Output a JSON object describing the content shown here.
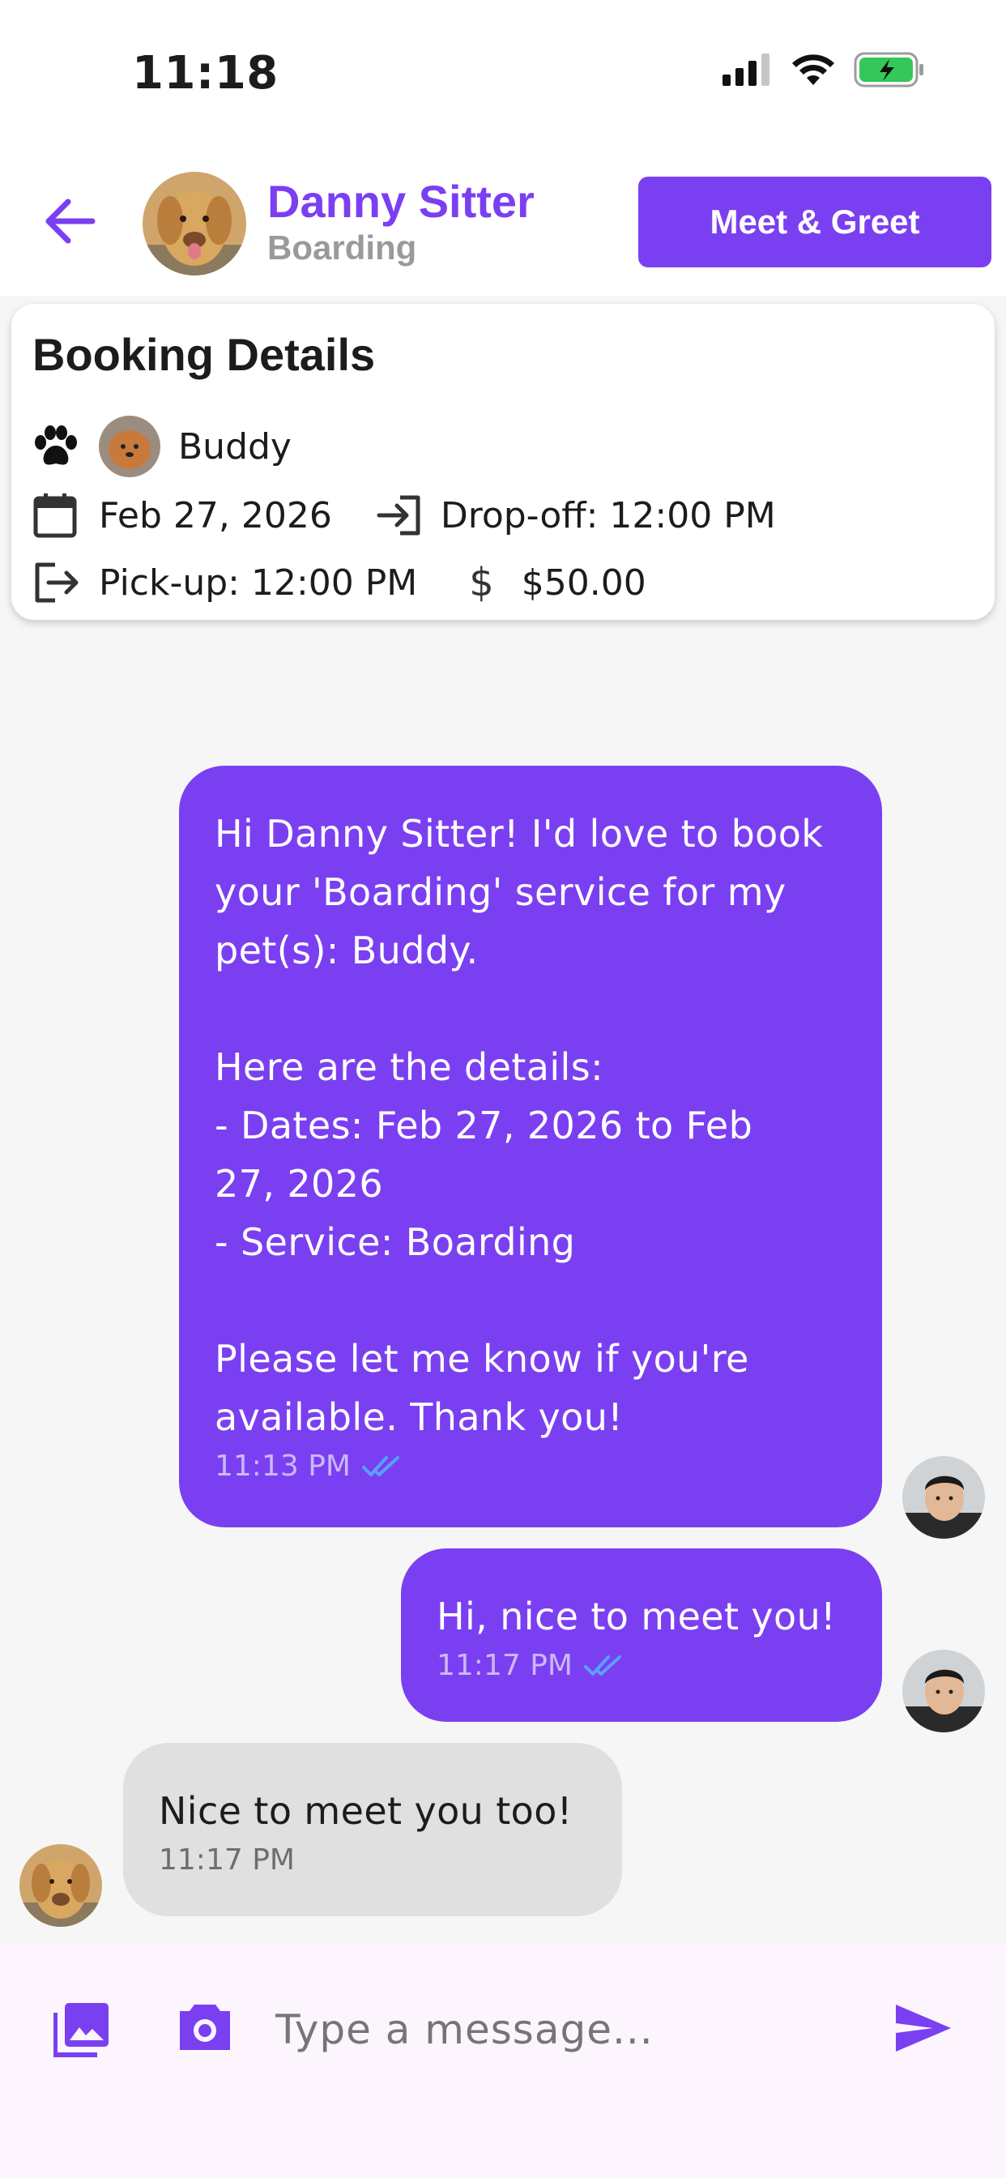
{
  "status_bar": {
    "time": "11:18"
  },
  "header": {
    "name": "Danny Sitter",
    "subtitle": "Boarding",
    "meet_button_label": "Meet & Greet"
  },
  "booking": {
    "title": "Booking Details",
    "pet_name": "Buddy",
    "date": "Feb 27, 2026",
    "dropoff": "Drop-off: 12:00 PM",
    "pickup": "Pick-up: 12:00 PM",
    "price": "$50.00"
  },
  "messages": [
    {
      "direction": "outgoing",
      "text": "Hi Danny Sitter! I'd love to book\nyour 'Boarding' service for my\npet(s): Buddy.\n\nHere are the details:\n- Dates: Feb 27, 2026 to Feb\n27, 2026\n- Service: Boarding\n\nPlease let me know if you're\navailable. Thank you!",
      "time": "11:13 PM",
      "status": "read"
    },
    {
      "direction": "outgoing",
      "text": "Hi, nice to meet you!",
      "time": "11:17 PM",
      "status": "read"
    },
    {
      "direction": "incoming",
      "text": "Nice to meet you too!",
      "time": "11:17 PM"
    }
  ],
  "input": {
    "placeholder": "Type a message..."
  },
  "colors": {
    "accent": "#7b3ff2",
    "incoming_bubble": "#e0e0e0",
    "input_bar_bg": "#fdf5fd",
    "read_check": "#5aa0ff",
    "battery": "#34c759"
  },
  "icons": {
    "back": "arrow-left-icon",
    "paw": "paw-icon",
    "calendar": "calendar-icon",
    "dropoff": "login-icon",
    "pickup": "logout-icon",
    "price": "dollar-icon",
    "gallery": "image-icon",
    "camera": "camera-icon",
    "send": "send-icon"
  }
}
